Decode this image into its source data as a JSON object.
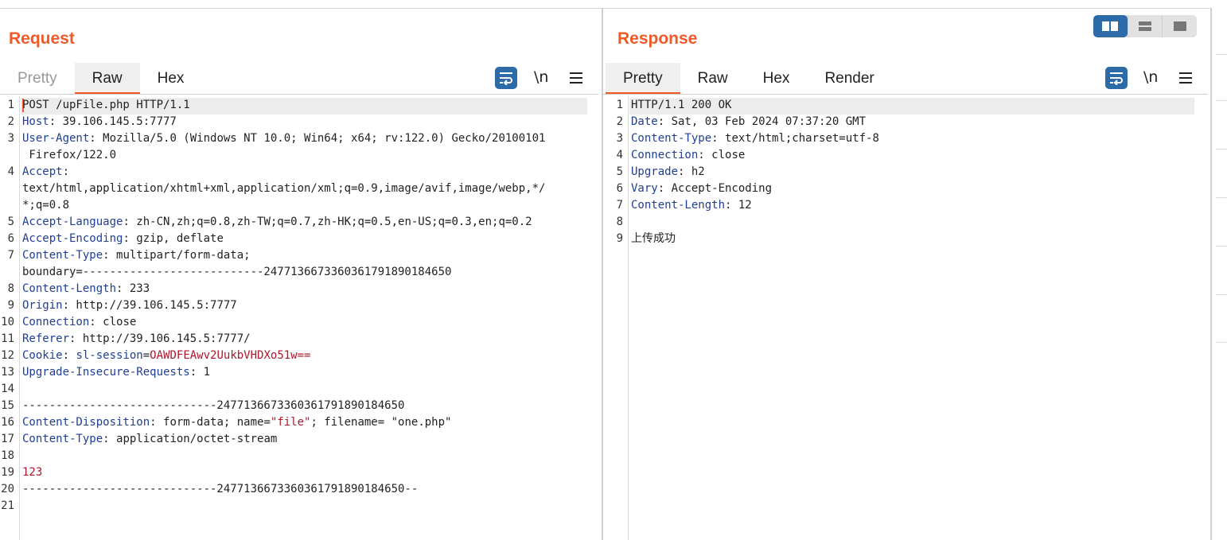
{
  "request": {
    "title": "Request",
    "tabs": [
      "Pretty",
      "Raw",
      "Hex"
    ],
    "active_tab": "Raw",
    "toolbar": {
      "newline_label": "\\n"
    },
    "lines": [
      {
        "n": "1",
        "parts": [
          {
            "t": "POST /upFile.php HTTP/1.1",
            "c": "v"
          }
        ]
      },
      {
        "n": "2",
        "parts": [
          {
            "t": "Host",
            "c": "k"
          },
          {
            "t": ": 39.106.145.5:7777",
            "c": "v"
          }
        ]
      },
      {
        "n": "3",
        "parts": [
          {
            "t": "User-Agent",
            "c": "k"
          },
          {
            "t": ": Mozilla/5.0 (Windows NT 10.0; Win64; x64; rv:122.0) Gecko/20100101",
            "c": "v"
          }
        ]
      },
      {
        "n": "",
        "parts": [
          {
            "t": " Firefox/122.0",
            "c": "v"
          }
        ]
      },
      {
        "n": "4",
        "parts": [
          {
            "t": "Accept",
            "c": "k"
          },
          {
            "t": ":",
            "c": "v"
          }
        ]
      },
      {
        "n": "",
        "parts": [
          {
            "t": "text/html,application/xhtml+xml,application/xml;q=0.9,image/avif,image/webp,*/",
            "c": "v"
          }
        ]
      },
      {
        "n": "",
        "parts": [
          {
            "t": "*;q=0.8",
            "c": "v"
          }
        ]
      },
      {
        "n": "5",
        "parts": [
          {
            "t": "Accept-Language",
            "c": "k"
          },
          {
            "t": ": zh-CN,zh;q=0.8,zh-TW;q=0.7,zh-HK;q=0.5,en-US;q=0.3,en;q=0.2",
            "c": "v"
          }
        ]
      },
      {
        "n": "6",
        "parts": [
          {
            "t": "Accept-Encoding",
            "c": "k"
          },
          {
            "t": ": gzip, deflate",
            "c": "v"
          }
        ]
      },
      {
        "n": "7",
        "parts": [
          {
            "t": "Content-Type",
            "c": "k"
          },
          {
            "t": ": multipart/form-data;",
            "c": "v"
          }
        ]
      },
      {
        "n": "",
        "parts": [
          {
            "t": "boundary=---------------------------247713667336036179189018465​0",
            "c": "v"
          }
        ]
      },
      {
        "n": "8",
        "parts": [
          {
            "t": "Content-Length",
            "c": "k"
          },
          {
            "t": ": 233",
            "c": "v"
          }
        ]
      },
      {
        "n": "9",
        "parts": [
          {
            "t": "Origin",
            "c": "k"
          },
          {
            "t": ": http://39.106.145.5:7777",
            "c": "v"
          }
        ]
      },
      {
        "n": "10",
        "parts": [
          {
            "t": "Connection",
            "c": "k"
          },
          {
            "t": ": close",
            "c": "v"
          }
        ]
      },
      {
        "n": "11",
        "parts": [
          {
            "t": "Referer",
            "c": "k"
          },
          {
            "t": ": http://39.106.145.5:7777/",
            "c": "v"
          }
        ]
      },
      {
        "n": "12",
        "parts": [
          {
            "t": "Cookie",
            "c": "k"
          },
          {
            "t": ": ",
            "c": "v"
          },
          {
            "t": "sl-session",
            "c": "k"
          },
          {
            "t": "=",
            "c": "v"
          },
          {
            "t": "OAWDFEAwv2UukbVHDXo51w==",
            "c": "s"
          }
        ]
      },
      {
        "n": "13",
        "parts": [
          {
            "t": "Upgrade-Insecure-Requests",
            "c": "k"
          },
          {
            "t": ": 1",
            "c": "v"
          }
        ]
      },
      {
        "n": "14",
        "parts": []
      },
      {
        "n": "15",
        "parts": [
          {
            "t": "-----------------------------247713667336036179189018465​0",
            "c": "v"
          }
        ]
      },
      {
        "n": "16",
        "parts": [
          {
            "t": "Content-Disposition",
            "c": "k"
          },
          {
            "t": ": form-data; name=",
            "c": "v"
          },
          {
            "t": "\"file\"",
            "c": "s"
          },
          {
            "t": "; filename= \"one.php\"",
            "c": "v"
          }
        ]
      },
      {
        "n": "17",
        "parts": [
          {
            "t": "Content-Type",
            "c": "k"
          },
          {
            "t": ": application/octet-stream",
            "c": "v"
          }
        ]
      },
      {
        "n": "18",
        "parts": []
      },
      {
        "n": "19",
        "parts": [
          {
            "t": "123",
            "c": "s"
          }
        ]
      },
      {
        "n": "20",
        "parts": [
          {
            "t": "-----------------------------247713667336036179189018465​0--",
            "c": "v"
          }
        ]
      },
      {
        "n": "21",
        "parts": []
      }
    ]
  },
  "response": {
    "title": "Response",
    "tabs": [
      "Pretty",
      "Raw",
      "Hex",
      "Render"
    ],
    "active_tab": "Pretty",
    "toolbar": {
      "newline_label": "\\n"
    },
    "lines": [
      {
        "n": "1",
        "parts": [
          {
            "t": "HTTP/1.1 200 OK",
            "c": "v"
          }
        ]
      },
      {
        "n": "2",
        "parts": [
          {
            "t": "Date",
            "c": "k"
          },
          {
            "t": ": Sat, 03 Feb 2024 07:37:20 GMT",
            "c": "v"
          }
        ]
      },
      {
        "n": "3",
        "parts": [
          {
            "t": "Content-Type",
            "c": "k"
          },
          {
            "t": ": text/html;charset=utf-8",
            "c": "v"
          }
        ]
      },
      {
        "n": "4",
        "parts": [
          {
            "t": "Connection",
            "c": "k"
          },
          {
            "t": ": close",
            "c": "v"
          }
        ]
      },
      {
        "n": "5",
        "parts": [
          {
            "t": "Upgrade",
            "c": "k"
          },
          {
            "t": ": h2",
            "c": "v"
          }
        ]
      },
      {
        "n": "6",
        "parts": [
          {
            "t": "Vary",
            "c": "k"
          },
          {
            "t": ": Accept-Encoding",
            "c": "v"
          }
        ]
      },
      {
        "n": "7",
        "parts": [
          {
            "t": "Content-Length",
            "c": "k"
          },
          {
            "t": ": 12",
            "c": "v"
          }
        ]
      },
      {
        "n": "8",
        "parts": []
      },
      {
        "n": "9",
        "parts": [
          {
            "t": "上传成功",
            "c": "v"
          }
        ]
      }
    ]
  },
  "colors": {
    "accent": "#f05a28",
    "header_key": "#1f3e95",
    "string": "#b0172c",
    "icon_bg": "#2d6aa8"
  },
  "icons": {
    "wrap": "word-wrap-icon",
    "menu": "hamburger-menu-icon",
    "layout": [
      "layout-side-by-side-icon",
      "layout-stacked-icon",
      "layout-single-icon"
    ]
  }
}
